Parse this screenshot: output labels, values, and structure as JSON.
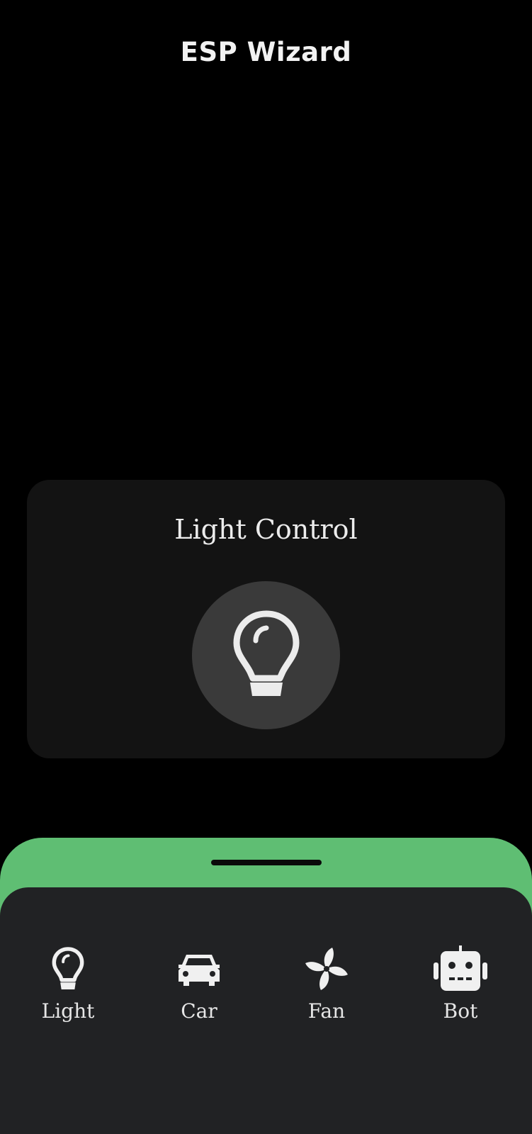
{
  "header": {
    "title": "ESP Wizard"
  },
  "card": {
    "title": "Light Control",
    "toggle_icon": "lightbulb-icon"
  },
  "nav": {
    "items": [
      {
        "label": "Light",
        "icon": "lightbulb-icon"
      },
      {
        "label": "Car",
        "icon": "car-icon"
      },
      {
        "label": "Fan",
        "icon": "fan-icon"
      },
      {
        "label": "Bot",
        "icon": "robot-icon"
      }
    ]
  },
  "colors": {
    "background": "#000000",
    "card": "#131313",
    "toggle": "#3a3a3a",
    "accent": "#5fbe73",
    "nav_sheet": "#212224",
    "text": "#ececec"
  }
}
